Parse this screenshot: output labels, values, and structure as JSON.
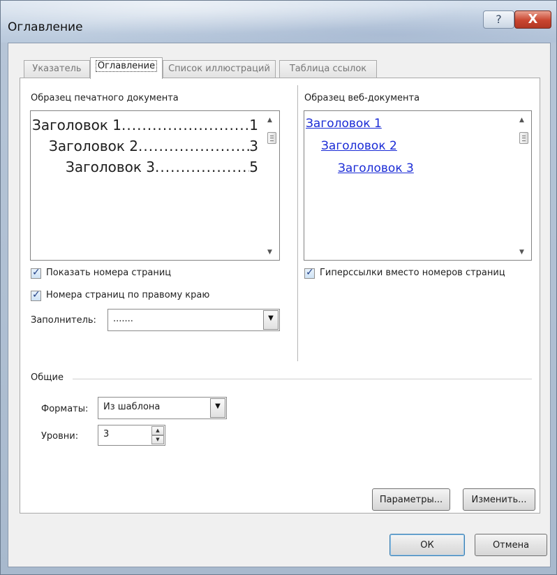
{
  "window": {
    "title": "Оглавление",
    "help_glyph": "?",
    "close_glyph": "X"
  },
  "tabs": [
    {
      "label": "Указатель",
      "active": false
    },
    {
      "label": "Оглавление",
      "active": true
    },
    {
      "label": "Список иллюстраций",
      "active": false
    },
    {
      "label": "Таблица ссылок",
      "active": false
    }
  ],
  "print_preview": {
    "label": "Образец печатного документа",
    "entries": [
      {
        "text": "Заголовок 1",
        "page": "1"
      },
      {
        "text": "Заголовок 2",
        "page": "3"
      },
      {
        "text": "Заголовок 3",
        "page": "5"
      }
    ]
  },
  "web_preview": {
    "label": "Образец веб-документа",
    "links": [
      "Заголовок 1",
      "Заголовок 2",
      "Заголовок 3"
    ],
    "link_color": "#1a2bd6"
  },
  "options": {
    "show_page_numbers": {
      "label": "Показать номера страниц",
      "checked": true
    },
    "right_align_numbers": {
      "label": "Номера страниц по правому краю",
      "checked": true
    },
    "hyperlinks": {
      "label": "Гиперссылки вместо номеров страниц",
      "checked": true
    },
    "leader_label": "Заполнитель:",
    "leader_value": "......."
  },
  "general": {
    "section_label": "Общие",
    "formats_label": "Форматы:",
    "formats_value": "Из шаблона",
    "levels_label": "Уровни:",
    "levels_value": "3"
  },
  "buttons": {
    "options": "Параметры...",
    "modify": "Изменить...",
    "ok": "ОК",
    "cancel": "Отмена"
  },
  "icons": {
    "help": "question-icon",
    "close": "close-icon",
    "dropdown": "chevron-down-icon",
    "spin_up": "arrow-up-icon",
    "spin_down": "arrow-down-icon"
  },
  "colors": {
    "close_button": "#c9452f",
    "title_bar": "#c7d5e6",
    "checkmark": "#1f3f86"
  }
}
